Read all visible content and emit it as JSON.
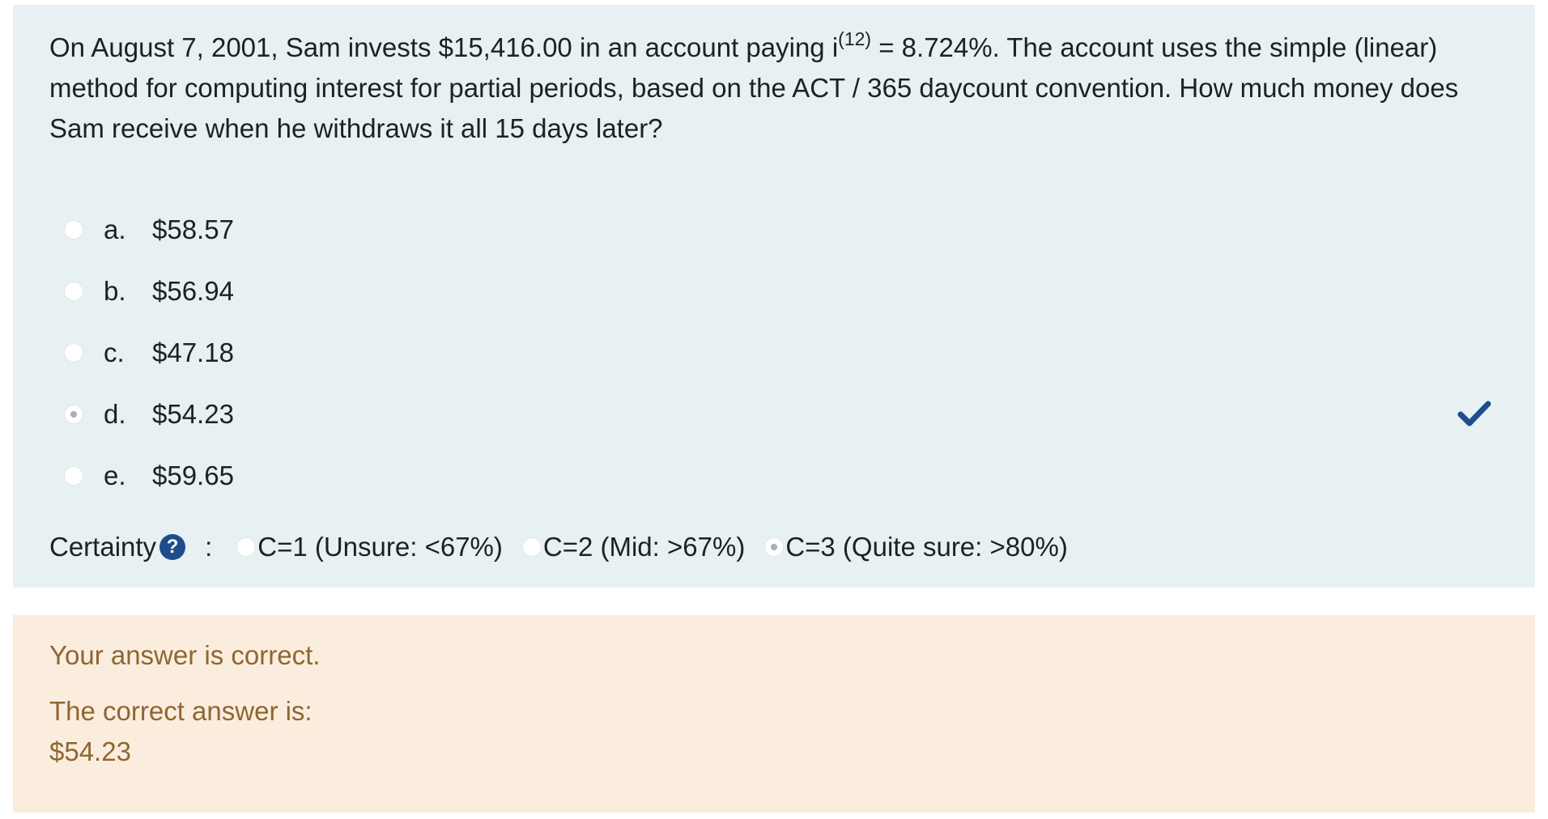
{
  "question": {
    "text_before_sup": "On August 7, 2001, Sam invests $15,416.00 in an account paying i",
    "sup": "(12)",
    "text_after_sup": " = 8.724%. The account uses the simple (linear) method for computing interest for partial periods, based on the ACT / 365 daycount convention. How much money does Sam receive when he withdraws it all 15 days later?"
  },
  "answers": [
    {
      "letter": "a.",
      "value": "$58.57",
      "selected": false
    },
    {
      "letter": "b.",
      "value": "$56.94",
      "selected": false
    },
    {
      "letter": "c.",
      "value": "$47.18",
      "selected": false
    },
    {
      "letter": "d.",
      "value": "$54.23",
      "selected": true
    },
    {
      "letter": "e.",
      "value": "$59.65",
      "selected": false
    }
  ],
  "certainty": {
    "label": "Certainty",
    "help_icon": "?",
    "colon": ":",
    "options": [
      {
        "label": "C=1 (Unsure: <67%)",
        "selected": false
      },
      {
        "label": "C=2 (Mid: >67%)",
        "selected": false
      },
      {
        "label": "C=3 (Quite sure: >80%)",
        "selected": true
      }
    ]
  },
  "feedback": {
    "status": "Your answer is correct.",
    "correct_label": "The correct answer is:",
    "correct_value": "$54.23"
  },
  "colors": {
    "question_bg": "#e7f0f3",
    "feedback_bg": "#fbeddd",
    "feedback_text": "#8e6633",
    "check": "#1f4d8c"
  },
  "icons": {
    "correct": "checkmark-icon",
    "help": "question-mark-icon"
  }
}
